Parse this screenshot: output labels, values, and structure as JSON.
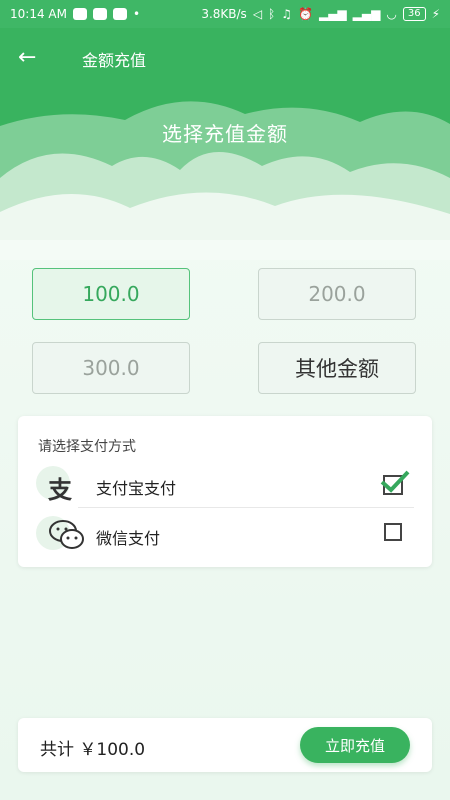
{
  "status_bar": {
    "time": "10:14 AM",
    "network_speed": "3.8KB/s",
    "battery": "36",
    "dot": "•"
  },
  "header": {
    "back_icon": "arrow-left-icon",
    "title": "金额充值",
    "hero_title": "选择充值金额"
  },
  "amounts": [
    {
      "label": "100.0",
      "selected": true
    },
    {
      "label": "200.0",
      "selected": false
    },
    {
      "label": "300.0",
      "selected": false
    },
    {
      "label": "其他金额",
      "selected": false
    }
  ],
  "payment": {
    "header": "请选择支付方式",
    "methods": [
      {
        "label": "支付宝支付",
        "icon": "alipay-icon",
        "checked": true
      },
      {
        "label": "微信支付",
        "icon": "wechat-icon",
        "checked": false
      }
    ]
  },
  "footer": {
    "total": "共计 ￥100.0",
    "button": "立即充值"
  },
  "colors": {
    "primary": "#39b35f",
    "selected_text": "#36a85d",
    "card_bg": "#ffffff"
  }
}
